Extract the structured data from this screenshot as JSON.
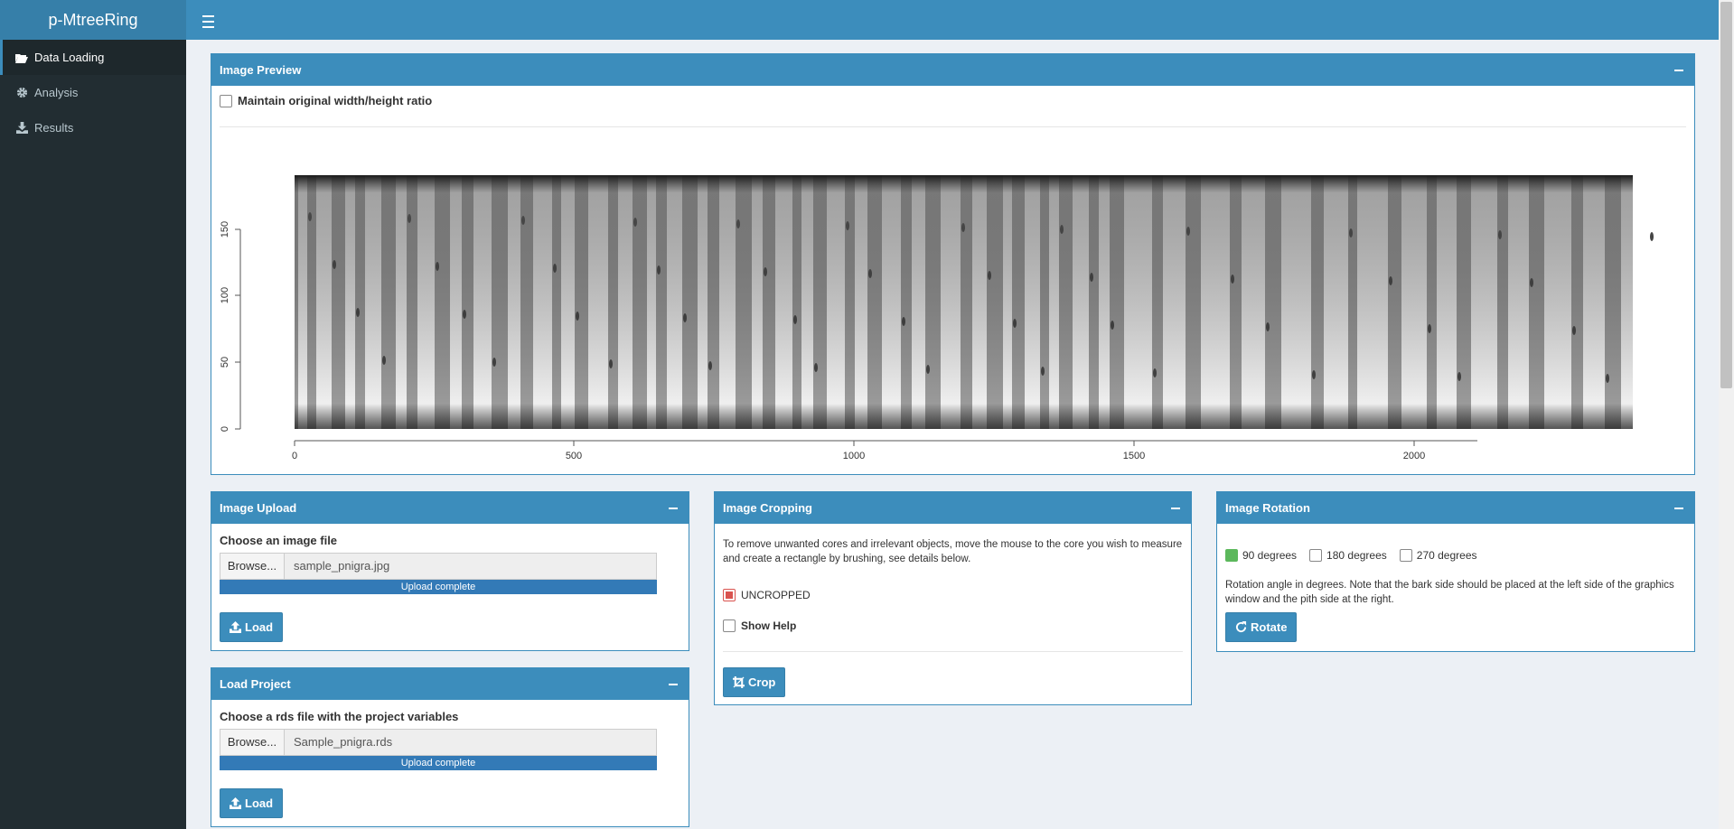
{
  "app": {
    "title": "p-MtreeRing"
  },
  "sidebar": {
    "items": [
      {
        "label": "Data Loading",
        "icon": "folder-open-icon"
      },
      {
        "label": "Analysis",
        "icon": "gear-icon"
      },
      {
        "label": "Results",
        "icon": "download-icon"
      }
    ]
  },
  "preview": {
    "title": "Image Preview",
    "ratio_label": "Maintain original width/height ratio",
    "plot": {
      "x_ticks": [
        "0",
        "500",
        "1000",
        "1500",
        "2000"
      ],
      "y_ticks": [
        "0",
        "50",
        "100",
        "150"
      ]
    }
  },
  "upload": {
    "title": "Image Upload",
    "prompt": "Choose an image file",
    "browse_label": "Browse...",
    "filename": "sample_pnigra.jpg",
    "progress_text": "Upload complete",
    "progress": 1.0,
    "load_label": "Load"
  },
  "project": {
    "title": "Load Project",
    "prompt": "Choose a rds file with the project variables",
    "browse_label": "Browse...",
    "filename": "Sample_pnigra.rds",
    "progress_text": "Upload complete",
    "progress": 1.0,
    "load_label": "Load"
  },
  "cropping": {
    "title": "Image Cropping",
    "description": "To remove unwanted cores and irrelevant objects, move the mouse to the core you wish to measure and create a rectangle by brushing, see details below.",
    "status_label": "UNCROPPED",
    "help_label": "Show Help",
    "crop_label": "Crop"
  },
  "rotation": {
    "title": "Image Rotation",
    "options": [
      "90 degrees",
      "180 degrees",
      "270 degrees"
    ],
    "selected": "90 degrees",
    "note": "Rotation angle in degrees. Note that the bark side should be placed at the left side of the graphics window and the pith side at the right.",
    "rotate_label": "Rotate"
  },
  "colors": {
    "primary": "#3c8dbc",
    "sidebar": "#222d32",
    "success": "#5cb85c",
    "danger": "#d9534f"
  }
}
